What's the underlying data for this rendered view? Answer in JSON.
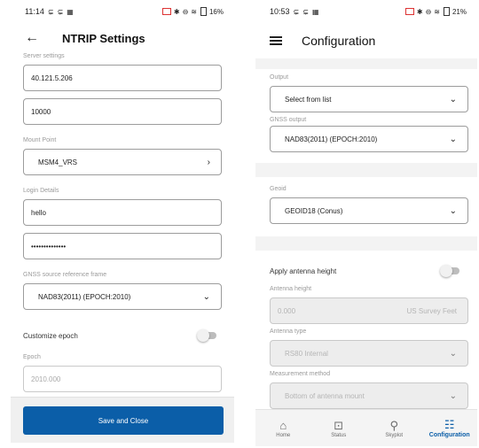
{
  "left": {
    "status": {
      "time": "11:14",
      "battery": "16%"
    },
    "title": "NTRIP Settings",
    "server_settings_label": "Server settings",
    "server_address": "40.121.5.206",
    "server_port": "10000",
    "mount_point_label": "Mount Point",
    "mount_point_value": "MSM4_VRS",
    "login_details_label": "Login Details",
    "username": "hello",
    "password_mask": "••••••••••••••",
    "gnss_source_label": "GNSS source reference frame",
    "gnss_source_value": "NAD83(2011) (EPOCH:2010)",
    "customize_epoch_label": "Customize epoch",
    "epoch_label": "Epoch",
    "epoch_placeholder": "2010.000",
    "save_label": "Save and Close"
  },
  "right": {
    "status": {
      "time": "10:53",
      "battery": "21%"
    },
    "title": "Configuration",
    "output_label": "Output",
    "output_value": "Select from list",
    "gnss_output_label": "GNSS output",
    "gnss_output_value": "NAD83(2011) (EPOCH:2010)",
    "geoid_label": "Geoid",
    "geoid_value": "GEOID18 (Conus)",
    "apply_antenna_label": "Apply antenna height",
    "antenna_height_label": "Antenna height",
    "antenna_height_value": "0.000",
    "antenna_height_unit": "US Survey Feet",
    "antenna_type_label": "Antenna type",
    "antenna_type_value": "RS80 Internal",
    "measurement_method_label": "Measurement method",
    "measurement_method_value": "Bottom of antenna mount",
    "nav": [
      {
        "label": "Home",
        "icon": "home-icon"
      },
      {
        "label": "Status",
        "icon": "status-icon"
      },
      {
        "label": "Skyplot",
        "icon": "satellite-icon"
      },
      {
        "label": "Configuration",
        "icon": "configuration-icon"
      }
    ]
  },
  "colors": {
    "accent": "#0b5ea8",
    "disabled_bg": "#ededed"
  }
}
